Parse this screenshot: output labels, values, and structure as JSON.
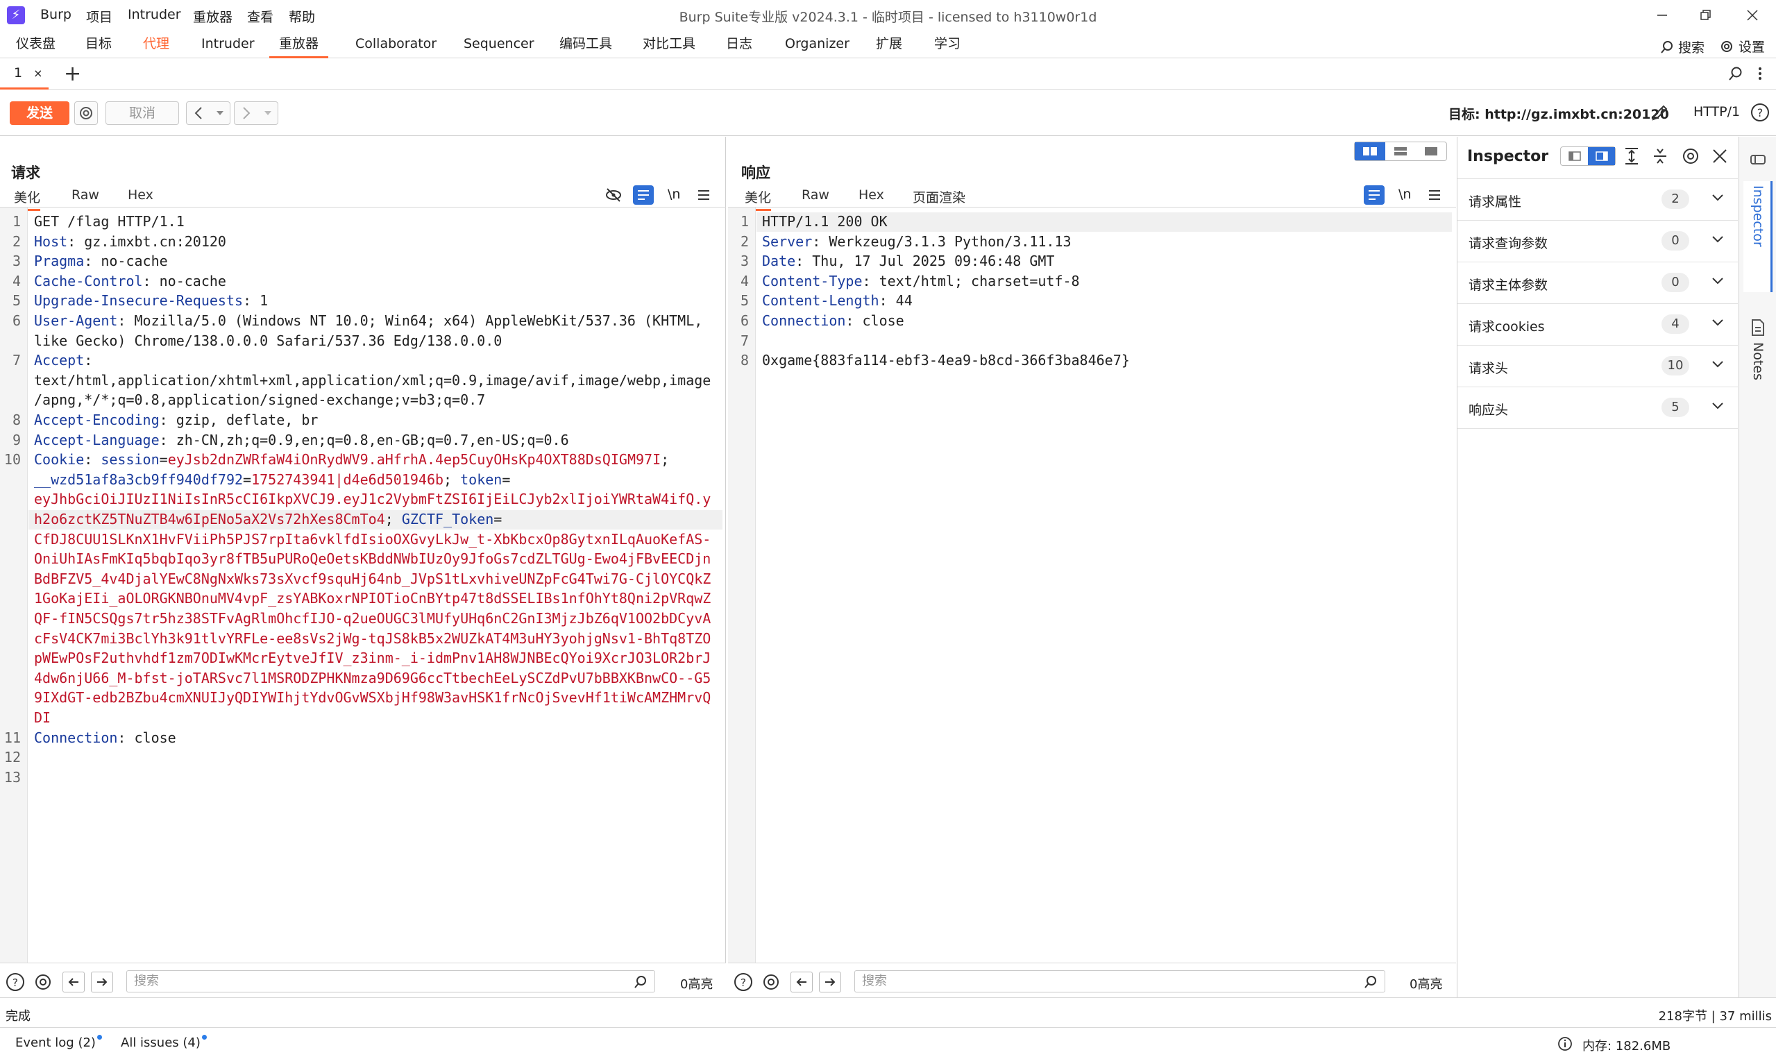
{
  "titlebar": {
    "menu": [
      "Burp",
      "项目",
      "Intruder",
      "重放器",
      "查看",
      "帮助"
    ],
    "title": "Burp Suite专业版  v2024.3.1 - 临时项目 - licensed to h3110w0r1d"
  },
  "maintabs": {
    "items": [
      "仪表盘",
      "目标",
      "代理",
      "Intruder",
      "重放器",
      "Collaborator",
      "Sequencer",
      "编码工具",
      "对比工具",
      "日志",
      "Organizer",
      "扩展",
      "学习"
    ],
    "search_label": "搜索",
    "settings_label": "设置"
  },
  "repeater": {
    "tab_label": "1",
    "tab_close": "×",
    "add_tab": "+"
  },
  "toolbar": {
    "send_label": "发送",
    "cancel_label": "取消",
    "target_label": "目标: http://gz.imxbt.cn:20120",
    "http_version": "HTTP/1"
  },
  "request": {
    "title": "请求",
    "tabs": [
      "美化",
      "Raw",
      "Hex"
    ],
    "newline_label": "\\n",
    "lines": [
      {
        "n": "1",
        "parts": [
          [
            "v",
            "GET /flag HTTP/1.1"
          ]
        ]
      },
      {
        "n": "2",
        "parts": [
          [
            "k",
            "Host"
          ],
          [
            "v",
            ": gz.imxbt.cn:20120"
          ]
        ]
      },
      {
        "n": "3",
        "parts": [
          [
            "k",
            "Pragma"
          ],
          [
            "v",
            ": no-cache"
          ]
        ]
      },
      {
        "n": "4",
        "parts": [
          [
            "k",
            "Cache-Control"
          ],
          [
            "v",
            ": no-cache"
          ]
        ]
      },
      {
        "n": "5",
        "parts": [
          [
            "k",
            "Upgrade-Insecure-Requests"
          ],
          [
            "v",
            ": 1"
          ]
        ]
      },
      {
        "n": "6",
        "parts": [
          [
            "k",
            "User-Agent"
          ],
          [
            "v",
            ": Mozilla/5.0 (Windows NT 10.0; Win64; x64) AppleWebKit/537.36 (KHTML,"
          ]
        ]
      },
      {
        "n": "",
        "parts": [
          [
            "v",
            "like Gecko) Chrome/138.0.0.0 Safari/537.36 Edg/138.0.0.0"
          ]
        ]
      },
      {
        "n": "7",
        "parts": [
          [
            "k",
            "Accept"
          ],
          [
            "v",
            ":"
          ]
        ]
      },
      {
        "n": "",
        "parts": [
          [
            "v",
            "text/html,application/xhtml+xml,application/xml;q=0.9,image/avif,image/webp,image"
          ]
        ]
      },
      {
        "n": "",
        "parts": [
          [
            "v",
            "/apng,*/*;q=0.8,application/signed-exchange;v=b3;q=0.7"
          ]
        ]
      },
      {
        "n": "8",
        "parts": [
          [
            "k",
            "Accept-Encoding"
          ],
          [
            "v",
            ": gzip, deflate, br"
          ]
        ]
      },
      {
        "n": "9",
        "parts": [
          [
            "k",
            "Accept-Language"
          ],
          [
            "v",
            ": zh-CN,zh;q=0.9,en;q=0.8,en-GB;q=0.7,en-US;q=0.6"
          ]
        ]
      },
      {
        "n": "10",
        "parts": [
          [
            "k",
            "Cookie"
          ],
          [
            "v",
            ": "
          ],
          [
            "k",
            "session"
          ],
          [
            "v",
            "="
          ],
          [
            "r",
            "eyJsb2dnZWRfaW4iOnRydWV9.aHfrhA.4ep5CuyOHsKp4OXT88DsQIGM97I"
          ],
          [
            "v",
            ";"
          ]
        ]
      },
      {
        "n": "",
        "parts": [
          [
            "k",
            "__wzd51af8a3cb9ff940df792"
          ],
          [
            "v",
            "="
          ],
          [
            "r",
            "1752743941|d4e6d501946b"
          ],
          [
            "v",
            "; "
          ],
          [
            "k",
            "token"
          ],
          [
            "v",
            "="
          ]
        ]
      },
      {
        "n": "",
        "parts": [
          [
            "r",
            "eyJhbGciOiJIUzI1NiIsInR5cCI6IkpXVCJ9.eyJ1c2VybmFtZSI6IjEiLCJyb2xlIjoiYWRtaW4ifQ.y"
          ]
        ]
      },
      {
        "n": "",
        "parts": [
          [
            "r",
            "h2o6zctKZ5TNuZTB4w6IpENo5aX2Vs72hXes8CmTo4"
          ],
          [
            "v",
            "; "
          ],
          [
            "k",
            "GZCTF_Token"
          ],
          [
            "v",
            "="
          ]
        ]
      },
      {
        "n": "",
        "parts": [
          [
            "r",
            "CfDJ8CUU1SLKnX1HvFViiPh5PJS7rpIta6vklfdIsioOXGvyLkJw_t-XbKbcxOp8GytxnILqAuoKefAS-"
          ]
        ]
      },
      {
        "n": "",
        "parts": [
          [
            "r",
            "OniUhIAsFmKIq5bqbIqo3yr8fTB5uPURoQeOetsKBddNWbIUzOy9JfoGs7cdZLTGUg-Ewo4jFBvEECDjn"
          ]
        ]
      },
      {
        "n": "",
        "parts": [
          [
            "r",
            "BdBFZV5_4v4DjalYEwC8NgNxWks73sXvcf9squHj64nb_JVpS1tLxvhiveUNZpFcG4Twi7G-CjlOYCQkZ"
          ]
        ]
      },
      {
        "n": "",
        "parts": [
          [
            "r",
            "1GoKajEIi_aOLORGKNBOnuMV4vpF_zsYABKoxrNPIOTioCnBYtp47t8dSSELIBs1nfOhYt8Qni2pVRqwZ"
          ]
        ]
      },
      {
        "n": "",
        "parts": [
          [
            "r",
            "QF-fIN5CSQgs7tr5hz38STFvAgRlmOhcfIJO-q2ueOUGC3lMUfyUHq6nC2GnI3MjzJbZ6qV1OO2bDCyvA"
          ]
        ]
      },
      {
        "n": "",
        "parts": [
          [
            "r",
            "cFsV4CK7mi3BclYh3k91tlvYRFLe-ee8sVs2jWg-tqJS8kB5x2WUZkAT4M3uHY3yohjgNsv1-BhTq8TZO"
          ]
        ]
      },
      {
        "n": "",
        "parts": [
          [
            "r",
            "pWEwPOsF2uthvhdf1zm7ODIwKMcrEytveJfIV_z3inm-_i-idmPnv1AH8WJNBEcQYoi9XcrJO3LOR2brJ"
          ]
        ]
      },
      {
        "n": "",
        "parts": [
          [
            "r",
            "4dw6njU66_M-bfst-joTARSvc7l1MSRODZPHKNmza9D69G6ccTtbechEeLySCZdPvU7bBBXKBnwCO--G5"
          ]
        ]
      },
      {
        "n": "",
        "parts": [
          [
            "r",
            "9IXdGT-edb2BZbu4cmXNUIJyQDIYWIhjtYdvOGvWSXbjHf98W3avHSK1frNcOjSvevHf1tiWcAMZHMrvQ"
          ]
        ]
      },
      {
        "n": "",
        "parts": [
          [
            "r",
            "DI"
          ]
        ]
      },
      {
        "n": "11",
        "parts": [
          [
            "k",
            "Connection"
          ],
          [
            "v",
            ": close"
          ]
        ]
      },
      {
        "n": "12",
        "parts": []
      },
      {
        "n": "13",
        "parts": []
      }
    ],
    "search_placeholder": "搜索",
    "highlight_count": "0高亮"
  },
  "response": {
    "title": "响应",
    "tabs": [
      "美化",
      "Raw",
      "Hex",
      "页面渲染"
    ],
    "newline_label": "\\n",
    "lines": [
      {
        "n": "1",
        "parts": [
          [
            "v",
            "HTTP/1.1 200 OK"
          ]
        ]
      },
      {
        "n": "2",
        "parts": [
          [
            "k",
            "Server"
          ],
          [
            "v",
            ": Werkzeug/3.1.3 Python/3.11.13"
          ]
        ]
      },
      {
        "n": "3",
        "parts": [
          [
            "k",
            "Date"
          ],
          [
            "v",
            ": Thu, 17 Jul 2025 09:46:48 GMT"
          ]
        ]
      },
      {
        "n": "4",
        "parts": [
          [
            "k",
            "Content-Type"
          ],
          [
            "v",
            ": text/html; charset=utf-8"
          ]
        ]
      },
      {
        "n": "5",
        "parts": [
          [
            "k",
            "Content-Length"
          ],
          [
            "v",
            ": 44"
          ]
        ]
      },
      {
        "n": "6",
        "parts": [
          [
            "k",
            "Connection"
          ],
          [
            "v",
            ": close"
          ]
        ]
      },
      {
        "n": "7",
        "parts": []
      },
      {
        "n": "8",
        "parts": [
          [
            "v",
            "0xgame{883fa114-ebf3-4ea9-b8cd-366f3ba846e7}"
          ]
        ]
      }
    ],
    "search_placeholder": "搜索",
    "highlight_count": "0高亮"
  },
  "inspector": {
    "title": "Inspector",
    "rows": [
      {
        "label": "请求属性",
        "count": "2"
      },
      {
        "label": "请求查询参数",
        "count": "0"
      },
      {
        "label": "请求主体参数",
        "count": "0"
      },
      {
        "label": "请求cookies",
        "count": "4"
      },
      {
        "label": "请求头",
        "count": "10"
      },
      {
        "label": "响应头",
        "count": "5"
      }
    ]
  },
  "siderail": {
    "inspector_label": "Inspector",
    "notes_label": "Notes"
  },
  "status": {
    "left": "完成",
    "right": "218字节 | 37 millis"
  },
  "bottom": {
    "event_log": "Event log (2)",
    "all_issues": "All issues (4)",
    "memory": "内存: 182.6MB"
  },
  "colors": {
    "accent": "#ff6633",
    "header_key": "#1a3b9c",
    "cookie_value": "#c0162a",
    "toggle_active": "#2f6fd6"
  }
}
